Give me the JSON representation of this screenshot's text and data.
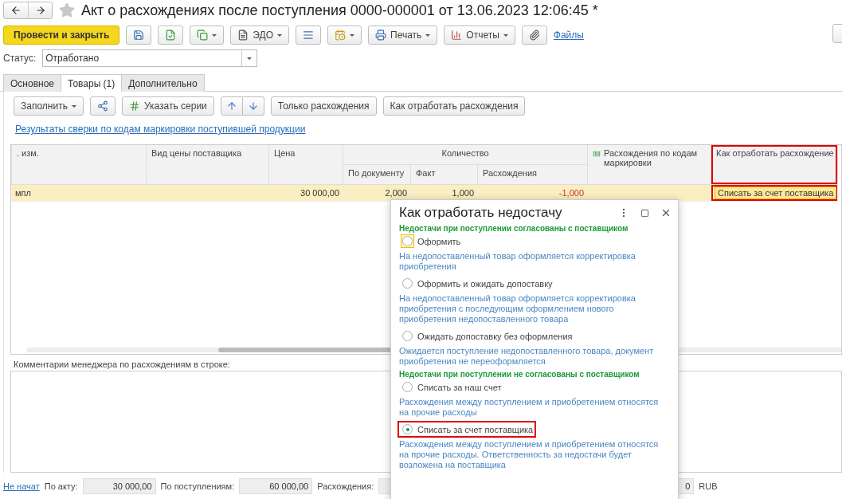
{
  "window": {
    "title": "Акт о расхождениях после поступления 0000-000001 от 13.06.2023 12:06:45 *",
    "starred": false
  },
  "toolbar": [
    {
      "kind": "primary",
      "label": "Провести и закрыть"
    },
    {
      "kind": "icon"
    },
    {
      "kind": "icon"
    },
    {
      "kind": "icon-menu"
    },
    {
      "kind": "menu",
      "label": "ЭДО"
    },
    {
      "kind": "icon"
    },
    {
      "kind": "icon-menu"
    },
    {
      "kind": "menu",
      "label": "Печать"
    },
    {
      "kind": "menu",
      "label": "Отчеты"
    },
    {
      "kind": "icon"
    },
    {
      "kind": "link",
      "label": "Файлы"
    }
  ],
  "status": {
    "label": "Статус:",
    "value": "Отработано"
  },
  "tabs": [
    {
      "label": "Основное",
      "selected": false
    },
    {
      "label": "Товары (1)",
      "selected": true
    },
    {
      "label": "Дополнительно",
      "selected": false
    }
  ],
  "goods_toolbar": [
    {
      "kind": "menu",
      "label": "Заполнить"
    },
    {
      "kind": "icon"
    },
    {
      "kind": "icon-text",
      "label": "Указать серии"
    },
    {
      "kind": "updown"
    },
    {
      "kind": "text",
      "label": "Только расхождения"
    },
    {
      "kind": "text",
      "label": "Как отработать расхождения"
    }
  ],
  "reconciliation_link": "Результаты сверки по кодам маркировки поступившей продукции",
  "table": {
    "column_groups": [
      {
        "label": "Количество"
      }
    ],
    "columns": [
      {
        "label": ". изм.",
        "highlighted": false,
        "grouped": false
      },
      {
        "label": "Вид цены поставщика",
        "highlighted": false,
        "grouped": false
      },
      {
        "label": "Цена",
        "highlighted": false,
        "grouped": false
      },
      {
        "label": "По документу",
        "highlighted": false,
        "grouped": true
      },
      {
        "label": "Факт",
        "highlighted": false,
        "grouped": true
      },
      {
        "label": "Расхождения",
        "highlighted": false,
        "grouped": true
      },
      {
        "label": "Расхождения по кодам маркировки",
        "highlighted": false,
        "grouped": false
      },
      {
        "label": "Как отработать расхождение",
        "highlighted": true,
        "grouped": false
      }
    ],
    "rows": [
      {
        "selected": true,
        "cells": [
          {
            "text": "мпл",
            "highlighted": false,
            "negative": false
          },
          {
            "text": "",
            "highlighted": false
          },
          {
            "text": "30 000,00",
            "highlighted": false,
            "negative": false
          },
          {
            "text": "2,000",
            "highlighted": false,
            "negative": false
          },
          {
            "text": "1,000",
            "highlighted": false,
            "negative": false
          },
          {
            "text": "-1,000",
            "highlighted": false,
            "negative": true
          },
          {
            "text": "",
            "highlighted": false
          },
          {
            "text": "Списать за счет поставщика",
            "highlighted": true,
            "negative": false
          }
        ]
      }
    ]
  },
  "comment": {
    "label": "Комментарии менеджера по расхождениям в строке:"
  },
  "footer": {
    "state_link": "Не начат",
    "totals": [
      {
        "label": "По акту:",
        "value": "30 000,00"
      },
      {
        "label": "По поступлениям:",
        "value": "60 000,00"
      },
      {
        "label": "Расхождения:",
        "value": "0"
      }
    ],
    "currency": "RUB"
  },
  "popup": {
    "title": "Как отработать недостачу",
    "groups": [
      {
        "heading": "Недостачи при поступлении согласованы с поставщиком",
        "options": [
          {
            "label": "Оформить",
            "description": "На недопоставленный товар оформляется корректировка приобретения",
            "selected": false,
            "focused": true,
            "highlighted": false
          },
          {
            "label": "Оформить и ожидать допоставку",
            "description": "На недопоставленный товар оформляется корректировка приобретения с последующим оформлением нового приобретения недопоставленного товара",
            "selected": false,
            "focused": false,
            "highlighted": false
          },
          {
            "label": "Ожидать допоставку без оформления",
            "description": "Ожидается поступление недопоставленного товара, документ приобретения не переоформляется",
            "selected": false,
            "focused": false,
            "highlighted": false
          }
        ]
      },
      {
        "heading": "Недостачи при поступлении не согласованы с поставщиком",
        "options": [
          {
            "label": "Списать за наш счет",
            "description": "Расхождения между поступлением и приобретением относятся на прочие расходы",
            "selected": false,
            "focused": false,
            "highlighted": false
          },
          {
            "label": "Списать за счет поставщика",
            "description": "Расхождения между поступлением и приобретением относятся на прочие расходы. Ответственность за недостачи будет возложена на поставщика",
            "selected": true,
            "focused": false,
            "highlighted": true
          }
        ]
      }
    ]
  }
}
